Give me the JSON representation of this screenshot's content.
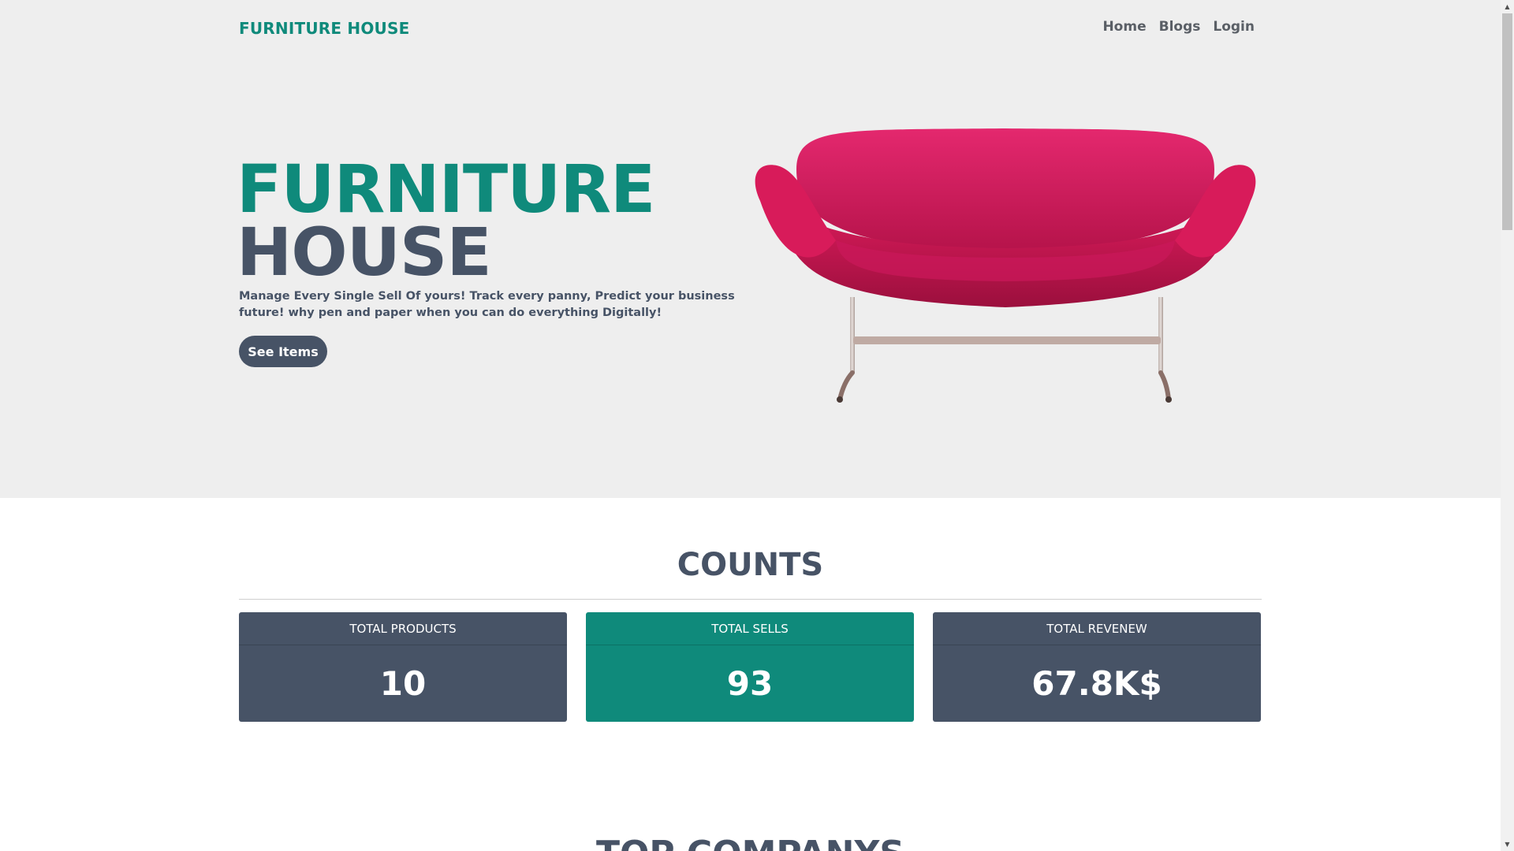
{
  "header": {
    "brand": "FURNITURE HOUSE",
    "nav": [
      "Home",
      "Blogs",
      "Login"
    ]
  },
  "hero": {
    "title_line1": "FURNITURE",
    "title_line2": "HOUSE",
    "description": "Manage Every Single Sell Of yours! Track every panny, Predict your business future! why pen and paper when you can do everything Digitally!",
    "cta_label": "See Items",
    "image": "pink-sofa-image"
  },
  "counts": {
    "title": "COUNTS",
    "cards": [
      {
        "label": "TOTAL PRODUCTS",
        "value": "10"
      },
      {
        "label": "TOTAL SELLS",
        "value": "93"
      },
      {
        "label": "TOTAL REVENEW",
        "value": "67.8K$"
      }
    ]
  },
  "next_section": {
    "title": "TOP COMPANYS"
  },
  "colors": {
    "accent": "#0f8a7b",
    "slate": "#475366",
    "hero_bg": "#eeeeee",
    "sofa": "#d81b5a"
  },
  "icons": [
    "scroll-up-icon",
    "scroll-down-icon"
  ]
}
